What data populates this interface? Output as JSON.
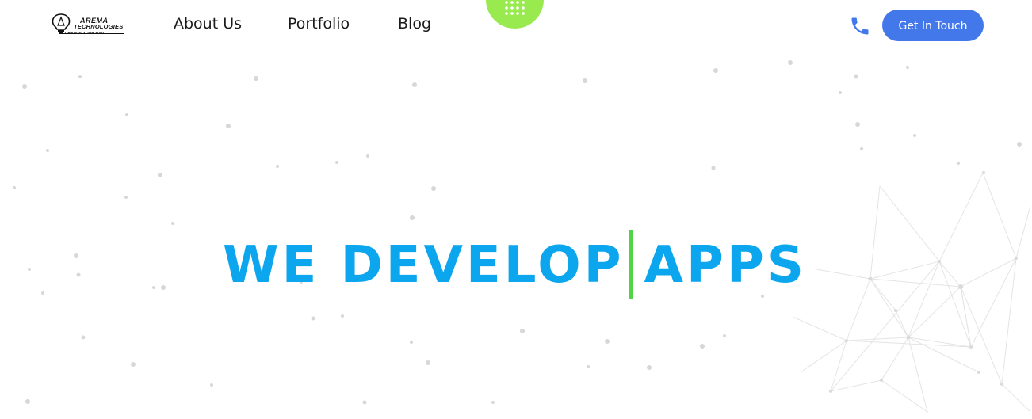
{
  "brand": {
    "name": "AREMA",
    "name2": "TECHNOLOGIES",
    "tagline": "CHANGE YOUR MIND"
  },
  "nav": {
    "items": [
      {
        "label": "About Us"
      },
      {
        "label": "Portfolio"
      },
      {
        "label": "Blog"
      }
    ],
    "menu_icon": "dots-grid-icon"
  },
  "header": {
    "phone_icon": "phone-icon",
    "cta_label": "Get In Touch"
  },
  "hero": {
    "text_before": "WE DEVELOP",
    "text_after": "APPS"
  },
  "colors": {
    "accent_blue": "#0ba6ee",
    "button_blue": "#4378eb",
    "green": "#99ea4f",
    "caret_green": "#51d44a",
    "dot_gray": "#d5d5d5"
  }
}
